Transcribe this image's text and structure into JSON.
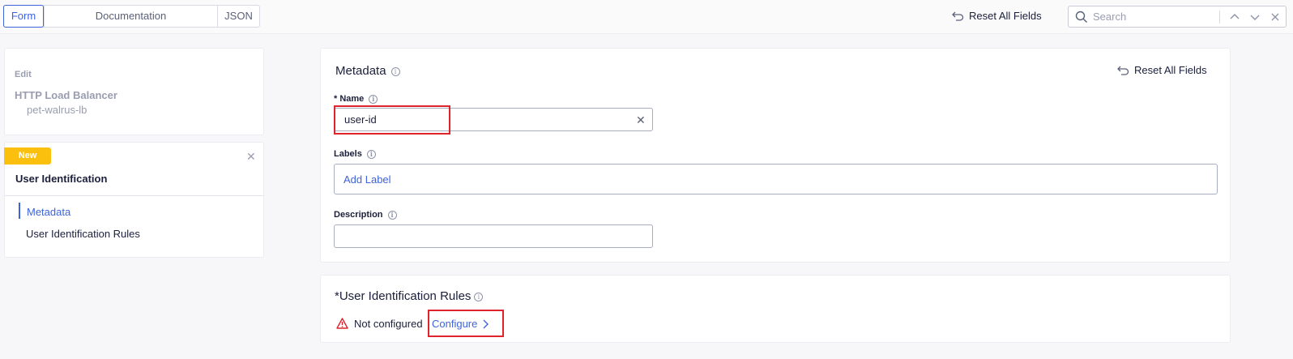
{
  "toolbar": {
    "tabs": [
      {
        "label": "Form",
        "active": true
      },
      {
        "label": "Documentation",
        "active": false
      },
      {
        "label": "JSON",
        "active": false
      }
    ],
    "reset_label": "Reset All Fields",
    "search_placeholder": "Search"
  },
  "sidebar": {
    "edit_label": "Edit",
    "object_type": "HTTP Load Balancer",
    "object_name": "pet-walrus-lb",
    "badge": "New",
    "section_title": "User Identification",
    "items": [
      {
        "label": "Metadata",
        "active": true
      },
      {
        "label": "User Identification Rules",
        "active": false
      }
    ]
  },
  "metadata": {
    "title": "Metadata",
    "reset_label": "Reset All Fields",
    "name_label": "* Name",
    "name_value": "user-id",
    "labels_label": "Labels",
    "add_label": "Add Label",
    "description_label": "Description",
    "description_value": ""
  },
  "rules": {
    "required_mark": "*",
    "title": "User Identification Rules",
    "status": "Not configured",
    "configure_label": "Configure"
  },
  "colors": {
    "accent": "#3d63dd",
    "badge": "#fbbf0e",
    "highlight": "#e0242c",
    "warning": "#e0242c"
  },
  "icons": [
    "reset-icon",
    "search-icon",
    "chevron-up-icon",
    "chevron-down-icon",
    "close-icon",
    "info-icon",
    "warning-icon",
    "chevron-right-icon"
  ]
}
